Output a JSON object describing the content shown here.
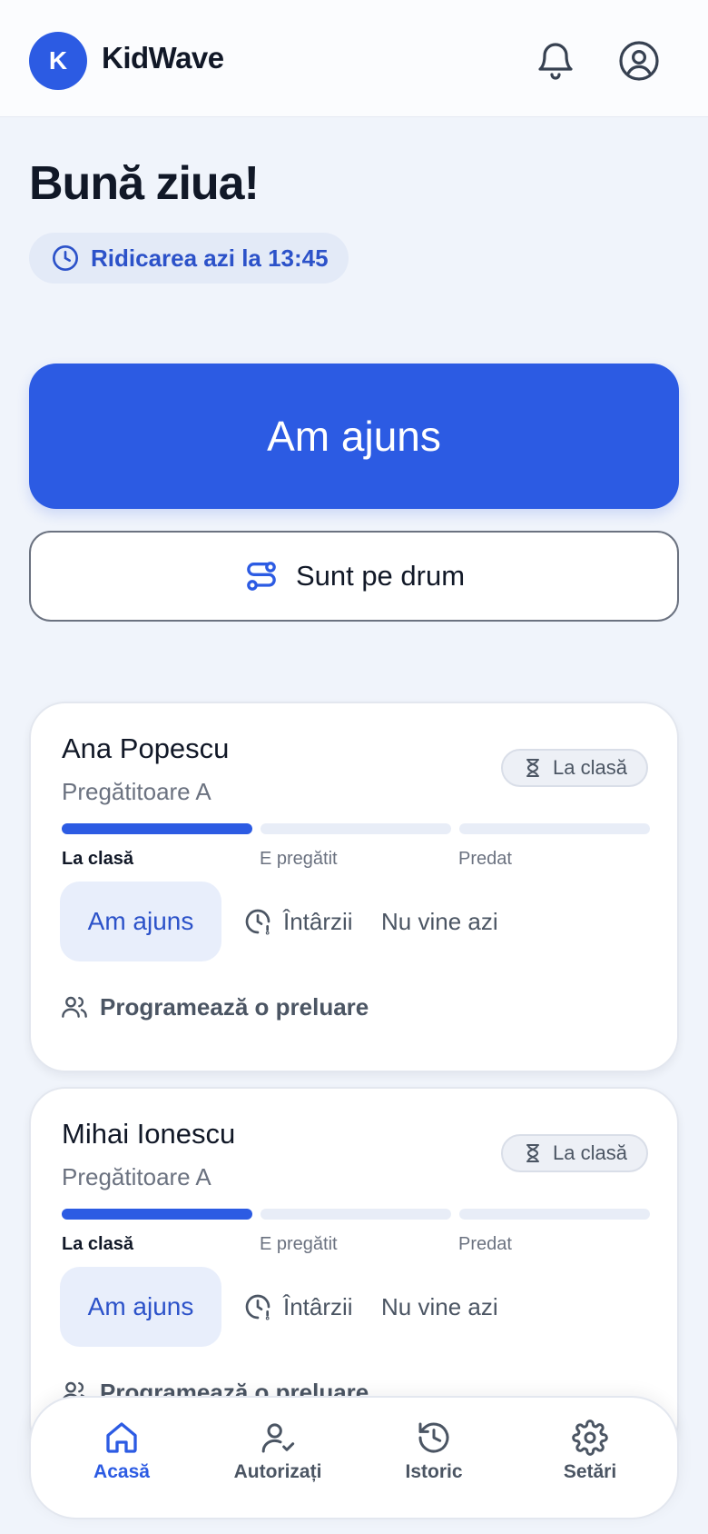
{
  "header": {
    "logo_letter": "K",
    "brand": "KidWave",
    "icons": [
      "bell-icon",
      "user-circle-icon"
    ]
  },
  "greeting": "Bună ziua!",
  "pickup_notice": "Ridicarea azi la 13:45",
  "primary_action": "Am ajuns",
  "secondary_action": "Sunt pe drum",
  "children": [
    {
      "name": "Ana Popescu",
      "class": "Pregătitoare A",
      "status": "La clasă",
      "progress_step": 1,
      "steps": [
        "La clasă",
        "E pregătit",
        "Predat"
      ],
      "actions": {
        "arrived": "Am ajuns",
        "late": "Întârzii",
        "absent": "Nu vine azi"
      },
      "schedule": "Programează o preluare"
    },
    {
      "name": "Mihai Ionescu",
      "class": "Pregătitoare A",
      "status": "La clasă",
      "progress_step": 1,
      "steps": [
        "La clasă",
        "E pregătit",
        "Predat"
      ],
      "actions": {
        "arrived": "Am ajuns",
        "late": "Întârzii",
        "absent": "Nu vine azi"
      },
      "schedule": "Programează o preluare"
    }
  ],
  "nav": {
    "items": [
      {
        "label": "Acasă",
        "icon": "home-icon",
        "active": true
      },
      {
        "label": "Autorizați",
        "icon": "user-check-icon",
        "active": false
      },
      {
        "label": "Istoric",
        "icon": "history-icon",
        "active": false
      },
      {
        "label": "Setări",
        "icon": "settings-icon",
        "active": false
      }
    ]
  },
  "colors": {
    "accent": "#2c5be3",
    "background": "#f0f4fb",
    "text": "#111827",
    "muted": "#6b7280"
  }
}
